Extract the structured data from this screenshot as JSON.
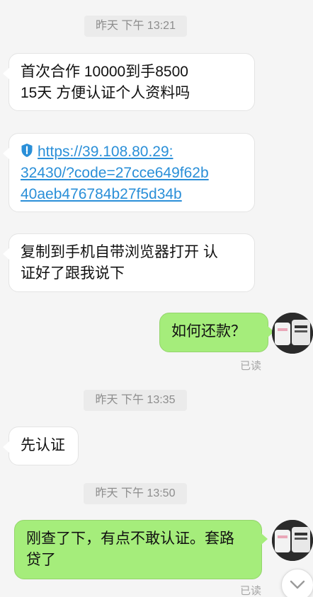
{
  "timestamps": [
    "昨天 下午 13:21",
    "昨天 下午 13:35",
    "昨天 下午 13:50"
  ],
  "messages": [
    {
      "lines": [
        "首次合作  10000到手8500",
        "15天     方便认证个人资料吗"
      ]
    },
    {
      "lines": [
        "https://39.108.80.29:",
        "32430/?code=27cce649f62b",
        "40aeb476784b27f5d34b"
      ]
    },
    {
      "lines": [
        "复制到手机自带浏览器打开    认",
        "证好了跟我说下"
      ]
    },
    {
      "lines": [
        "如何还款？"
      ]
    },
    {
      "lines": [
        "先认证"
      ]
    },
    {
      "lines": [
        "刚查了下，有点不敢认证。套路",
        "贷了"
      ]
    }
  ],
  "read_label": "已读",
  "colors": {
    "background": "#f5f5f5",
    "incoming_bubble": "#ffffff",
    "outgoing_bubble": "#a5ed7b",
    "link": "#2a8fd8"
  },
  "icons": [
    "shield-icon",
    "avatar",
    "chevron-down-icon"
  ]
}
